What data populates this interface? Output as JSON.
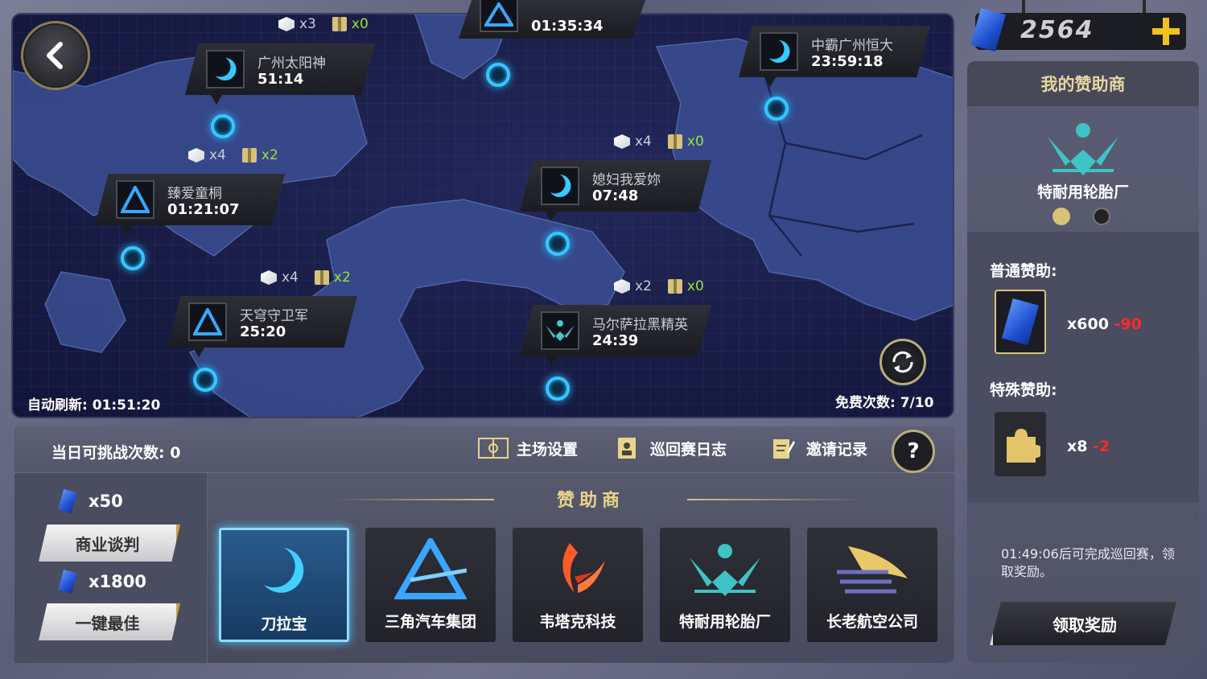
{
  "map": {
    "auto_refresh_label": "自动刷新: 01:51:20",
    "free_count_label": "免费次数: 7/10",
    "cards": [
      {
        "name": "广州太阳神",
        "time": "51:14",
        "logo": "crescent"
      },
      {
        "name": "",
        "time": "01:35:34",
        "logo": "triangle"
      },
      {
        "name": "中霸广州恒大",
        "time": "23:59:18",
        "logo": "crescent"
      },
      {
        "name": "臻爱童桐",
        "time": "01:21:07",
        "logo": "triangle"
      },
      {
        "name": "媳妇我爱妳",
        "time": "07:48",
        "logo": "crescent"
      },
      {
        "name": "天穹守卫军",
        "time": "25:20",
        "logo": "triangle"
      },
      {
        "name": "马尔萨拉黑精英",
        "time": "24:39",
        "logo": "wings"
      }
    ],
    "rewards": [
      {
        "box": "x3",
        "gift": "x0"
      },
      {
        "box": "x4",
        "gift": "x2"
      },
      {
        "box": "x4",
        "gift": "x0"
      },
      {
        "box": "x4",
        "gift": "x2"
      },
      {
        "box": "x2",
        "gift": "x0"
      }
    ]
  },
  "toolbar": {
    "daily_label": "当日可挑战次数: 0",
    "home_settings": "主场设置",
    "tour_log": "巡回赛日志",
    "invite_record": "邀请记录",
    "help": "?"
  },
  "left": {
    "cost1": "x50",
    "negotiate": "商业谈判",
    "cost2": "x1800",
    "best": "一键最佳"
  },
  "sponsors": {
    "title": "赞助商",
    "items": [
      {
        "label": "刀拉宝",
        "logo": "crescent",
        "selected": true
      },
      {
        "label": "三角汽车集团",
        "logo": "triangle",
        "selected": false
      },
      {
        "label": "韦塔克科技",
        "logo": "phoenix",
        "selected": false
      },
      {
        "label": "特耐用轮胎厂",
        "logo": "wings",
        "selected": false
      },
      {
        "label": "长老航空公司",
        "logo": "eagle",
        "selected": false
      }
    ]
  },
  "currency": {
    "amount": "2564",
    "icon": "blue-gem-icon"
  },
  "my_sponsor": {
    "title": "我的赞助商",
    "name": "特耐用轮胎厂",
    "normal_label": "普通赞助:",
    "normal_qty": "x600",
    "normal_delta": "-90",
    "special_label": "特殊赞助:",
    "special_qty": "x8",
    "special_delta": "-2",
    "info": "01:49:06后可完成巡回赛，领取奖励。",
    "claim": "领取奖励"
  },
  "colors": {
    "accent": "#36c6ff",
    "gold": "#c7a14a",
    "delta": "#ff2a2a",
    "reward_green": "#9be23c"
  }
}
